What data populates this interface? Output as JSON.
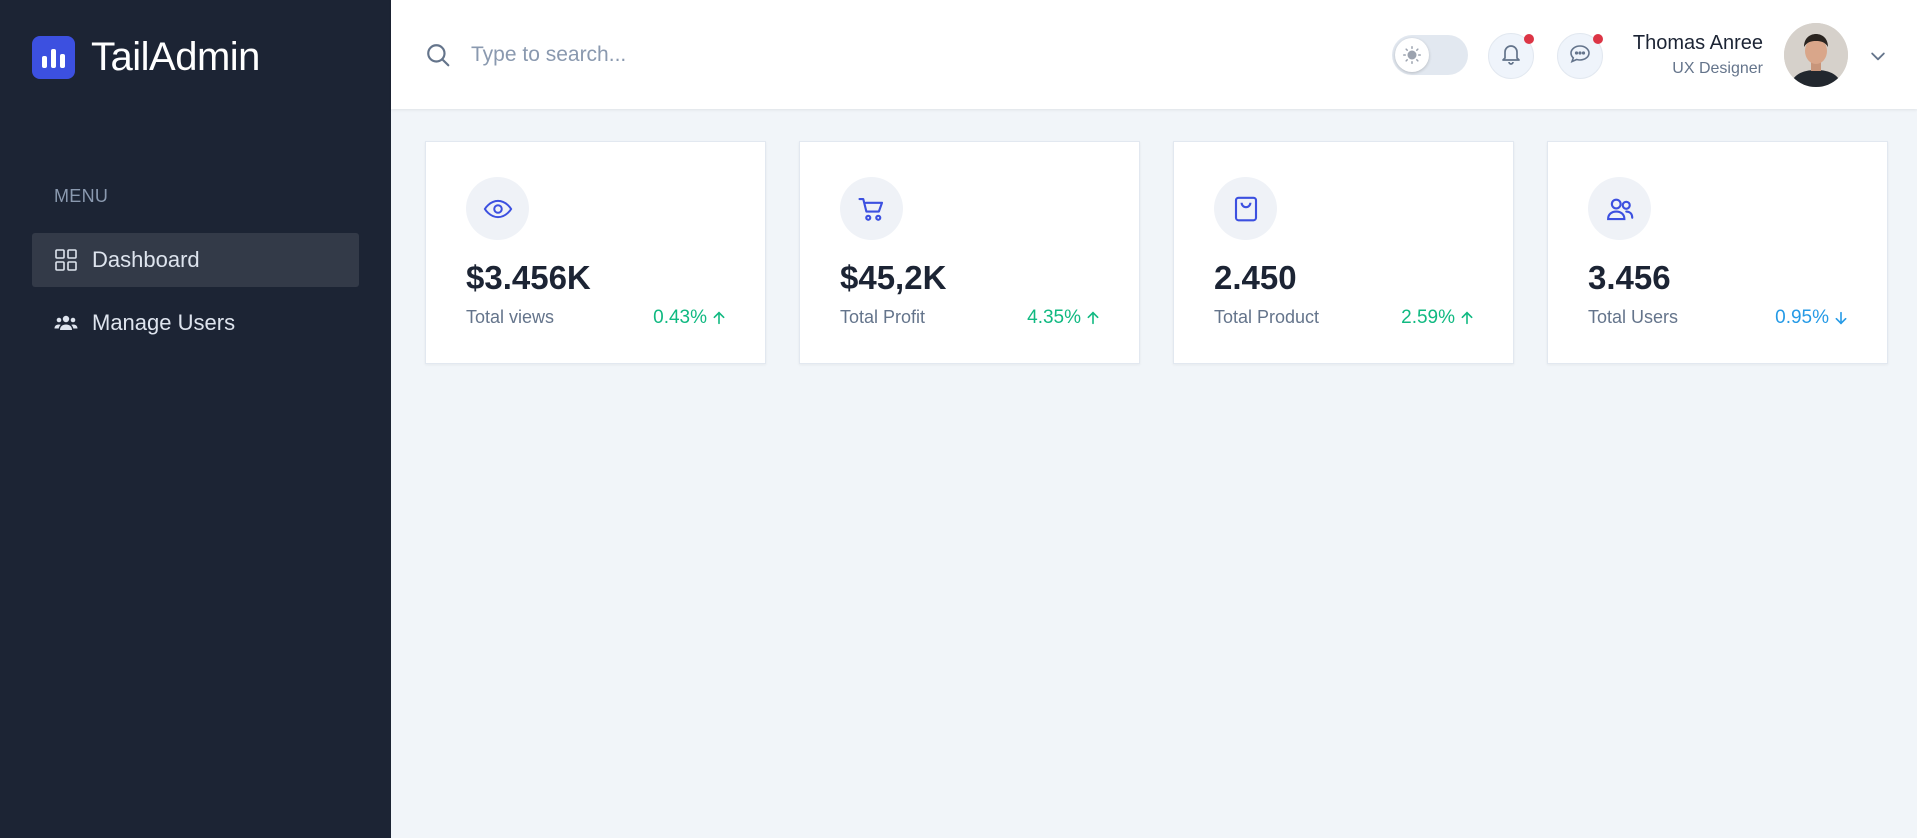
{
  "brand": {
    "name": "TailAdmin",
    "accent": "#3c50e0"
  },
  "sidebar": {
    "menu_label": "MENU",
    "items": [
      {
        "label": "Dashboard",
        "icon": "grid-icon",
        "active": true
      },
      {
        "label": "Manage Users",
        "icon": "users-icon",
        "active": false
      }
    ]
  },
  "header": {
    "search": {
      "placeholder": "Type to search...",
      "value": ""
    },
    "theme_toggle": {
      "mode": "light",
      "icon": "sun-icon"
    },
    "notifications": {
      "icon": "bell-icon",
      "has_unread": true
    },
    "messages": {
      "icon": "chat-icon",
      "has_unread": true
    },
    "user": {
      "name": "Thomas Anree",
      "role": "UX Designer"
    }
  },
  "stats": [
    {
      "icon": "eye-icon",
      "value": "$3.456K",
      "label": "Total views",
      "change": "0.43%",
      "direction": "up"
    },
    {
      "icon": "cart-icon",
      "value": "$45,2K",
      "label": "Total Profit",
      "change": "4.35%",
      "direction": "up"
    },
    {
      "icon": "bag-icon",
      "value": "2.450",
      "label": "Total Product",
      "change": "2.59%",
      "direction": "up"
    },
    {
      "icon": "users-icon",
      "value": "3.456",
      "label": "Total Users",
      "change": "0.95%",
      "direction": "down"
    }
  ],
  "colors": {
    "sidebar_bg": "#1c2434",
    "page_bg": "#f1f5f9",
    "positive": "#10b981",
    "negative": "#259ae6",
    "alert_dot": "#dc3545"
  }
}
